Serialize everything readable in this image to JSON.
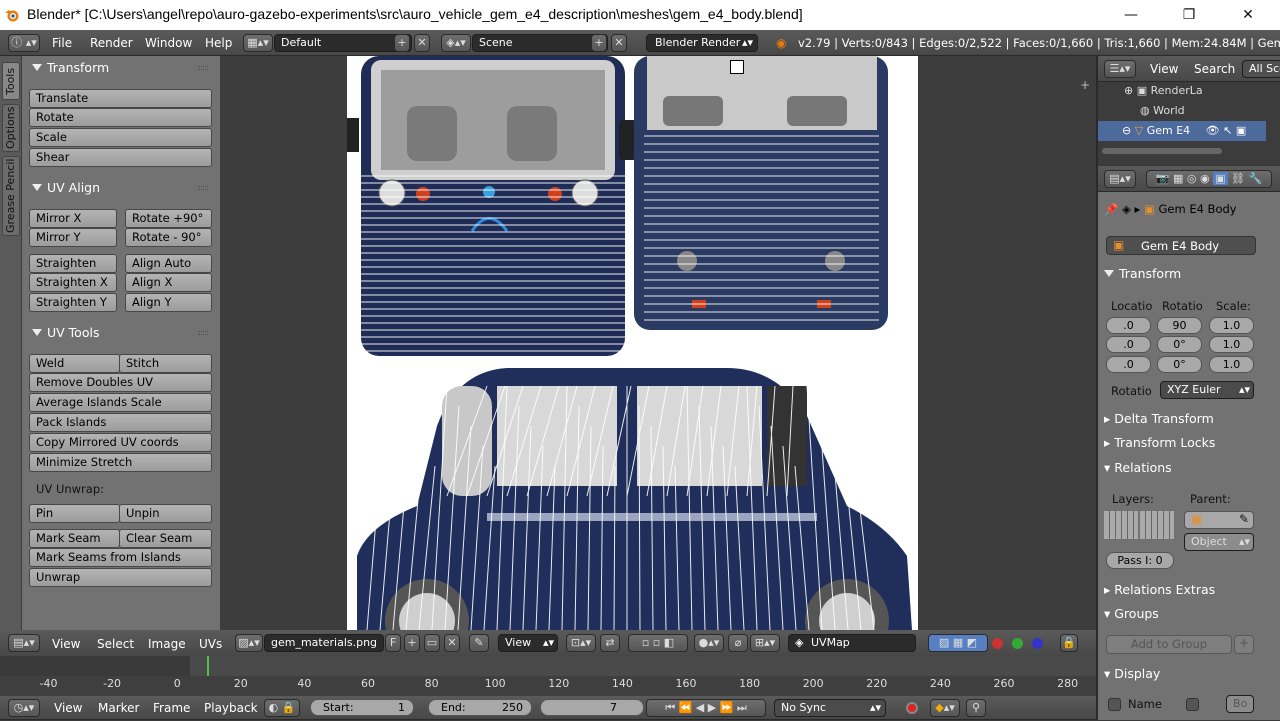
{
  "window": {
    "title": "Blender* [C:\\Users\\angel\\repo\\auro-gazebo-experiments\\src\\auro_vehicle_gem_e4_description\\meshes\\gem_e4_body.blend]",
    "minimize": "—",
    "maximize": "❐",
    "close": "✕"
  },
  "info_header": {
    "menus": [
      "File",
      "Render",
      "Window",
      "Help"
    ],
    "screen_layout": "Default",
    "scene": "Scene",
    "engine": "Blender Render",
    "stats": "v2.79 | Verts:0/843 | Edges:0/2,522 | Faces:0/1,660 | Tris:1,660 | Mem:24.84M | Gem E4 Body"
  },
  "tool_tabs": [
    "Tools",
    "Options",
    "Grease Pencil"
  ],
  "tool_shelf": {
    "transform": {
      "title": "Transform",
      "buttons": [
        "Translate",
        "Rotate",
        "Scale",
        "Shear"
      ]
    },
    "uv_align": {
      "title": "UV Align",
      "left": [
        "Mirror X",
        "Mirror Y",
        "Straighten",
        "Straighten X",
        "Straighten Y"
      ],
      "right": [
        "Rotate +90°",
        "Rotate  - 90°",
        "Align Auto",
        "Align X",
        "Align Y"
      ]
    },
    "uv_tools": {
      "title": "UV Tools",
      "weld": "Weld",
      "stitch": "Stitch",
      "remove_doubles": "Remove Doubles UV",
      "average_islands": "Average Islands Scale",
      "pack_islands": "Pack Islands",
      "copy_mirrored": "Copy Mirrored UV coords",
      "minimize_stretch": "Minimize Stretch",
      "unwrap_label": "UV Unwrap:",
      "pin": "Pin",
      "unpin": "Unpin",
      "mark_seam": "Mark Seam",
      "clear_seam": "Clear Seam",
      "mark_seams_islands": "Mark Seams from Islands",
      "unwrap": "Unwrap"
    }
  },
  "uv_header": {
    "menus": [
      "View",
      "Select",
      "Image",
      "UVs"
    ],
    "image_name": "gem_materials.png",
    "fake_user": "F",
    "view_mode": "View",
    "uv_map": "UVMap"
  },
  "outliner": {
    "view": "View",
    "search": "Search",
    "filter": "All Sce",
    "items": [
      "RenderLa",
      "World",
      "Gem E4"
    ]
  },
  "properties": {
    "object_path": "Gem E4 Body",
    "object_name": "Gem E4 Body",
    "transform": {
      "title": "Transform",
      "location_label": "Locatio",
      "rotation_label": "Rotatio",
      "scale_label": "Scale:",
      "location": [
        ".0",
        ".0",
        ".0"
      ],
      "rotation": [
        "90",
        "0°",
        "0°"
      ],
      "scale": [
        "1.0",
        "1.0",
        "1.0"
      ],
      "rotation_mode_label": "Rotatio",
      "rotation_mode": "XYZ Euler"
    },
    "delta_transform": "Delta Transform",
    "transform_locks": "Transform Locks",
    "relations": {
      "title": "Relations",
      "layers": "Layers:",
      "parent": "Parent:",
      "parent_type": "Object",
      "pass_index": "Pass I: 0"
    },
    "relations_extras": "Relations Extras",
    "groups": {
      "title": "Groups",
      "add": "Add to Group"
    },
    "display": {
      "title": "Display",
      "name": "Name",
      "bounds": "Bo"
    }
  },
  "timeline": {
    "ticks": [
      "-40",
      "-20",
      "0",
      "20",
      "40",
      "60",
      "80",
      "100",
      "120",
      "140",
      "160",
      "180",
      "200",
      "220",
      "240",
      "260",
      "280"
    ],
    "menus": [
      "View",
      "Marker",
      "Frame",
      "Playback"
    ],
    "start": "Start:",
    "start_value": "1",
    "end": "End:",
    "end_value": "250",
    "current_frame": "7",
    "sync": "No Sync"
  },
  "colors": {
    "panel_bg": "#727272",
    "header_bg": "#4f4f4f",
    "button": "#a9a9a9",
    "accent_blue": "#5680c2",
    "car_blue": "#1f2e5a"
  }
}
